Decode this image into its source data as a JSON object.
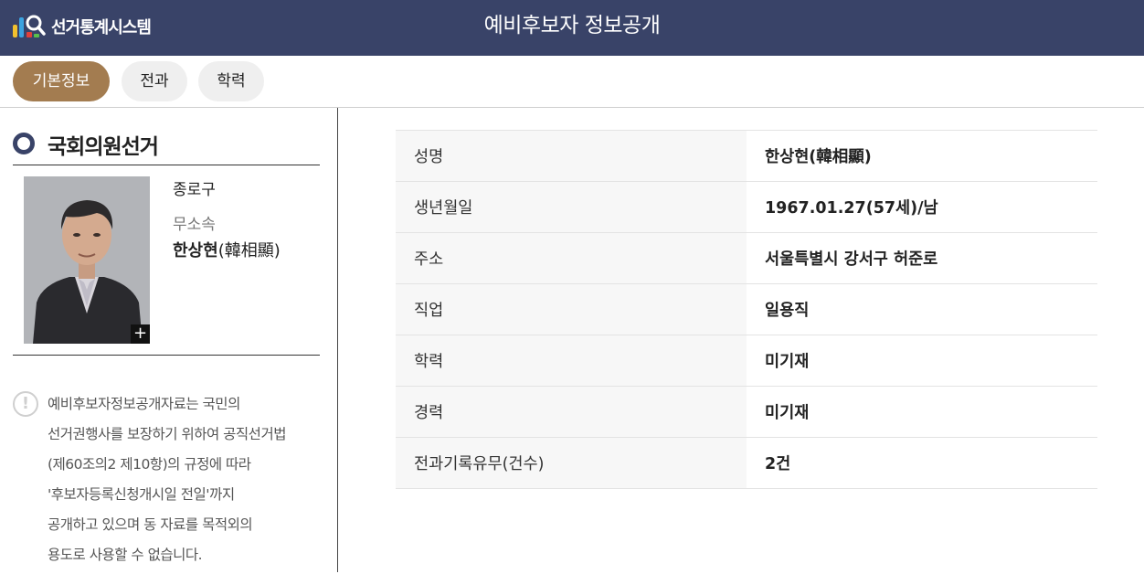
{
  "header": {
    "logo_text": "선거통계시스템",
    "title": "예비후보자 정보공개",
    "colors": {
      "bar": "#394368",
      "text": "#ffffff"
    }
  },
  "tabs": [
    {
      "label": "기본정보",
      "active": true
    },
    {
      "label": "전과",
      "active": false
    },
    {
      "label": "학력",
      "active": false
    }
  ],
  "accent": "#a37c50",
  "left": {
    "election_type": "국회의원선거",
    "district": "종로구",
    "party": "무소속",
    "name": "한상현",
    "name_hanja": "(韓相顯)",
    "zoom_label": "+",
    "notice_icon": "!",
    "notice_lines": [
      "예비후보자정보공개자료는 국민의",
      "선거권행사를 보장하기 위하여 공직선거법",
      "(제60조의2 제10항)의 규정에 따라",
      "'후보자등록신청개시일 전일'까지",
      "공개하고 있으며 동 자료를 목적외의",
      "용도로 사용할 수 없습니다."
    ]
  },
  "info": {
    "rows": [
      {
        "label": "성명",
        "value": "한상현(韓相顯)"
      },
      {
        "label": "생년월일",
        "value": "1967.01.27(57세)/남"
      },
      {
        "label": "주소",
        "value": "서울특별시 강서구 허준로"
      },
      {
        "label": "직업",
        "value": "일용직"
      },
      {
        "label": "학력",
        "value": "미기재"
      },
      {
        "label": "경력",
        "value": "미기재"
      },
      {
        "label": "전과기록유무(건수)",
        "value": "2건"
      }
    ]
  }
}
